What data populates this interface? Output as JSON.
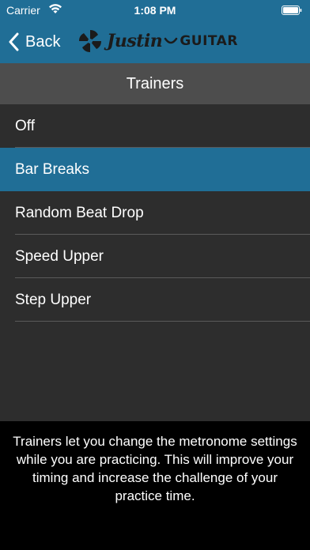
{
  "status_bar": {
    "carrier": "Carrier",
    "time": "1:08 PM",
    "wifi_icon": "wifi-icon",
    "battery_icon": "battery-icon"
  },
  "nav": {
    "back_label": "Back",
    "back_icon": "chevron-left-icon",
    "logo_script": "Justin",
    "logo_word": "GUITAR"
  },
  "header": {
    "title": "Trainers"
  },
  "trainers": {
    "items": [
      {
        "label": "Off",
        "selected": false
      },
      {
        "label": "Bar Breaks",
        "selected": true
      },
      {
        "label": "Random Beat Drop",
        "selected": false
      },
      {
        "label": "Speed Upper",
        "selected": false
      },
      {
        "label": "Step Upper",
        "selected": false
      }
    ]
  },
  "footer": {
    "description": "Trainers let you change the metronome settings while you are practicing.  This will improve your timing and increase the challenge of your practice time."
  },
  "colors": {
    "accent": "#206e96",
    "background": "#2d2d2d",
    "header_bg": "#4d4d4d",
    "footer_bg": "#000000"
  }
}
